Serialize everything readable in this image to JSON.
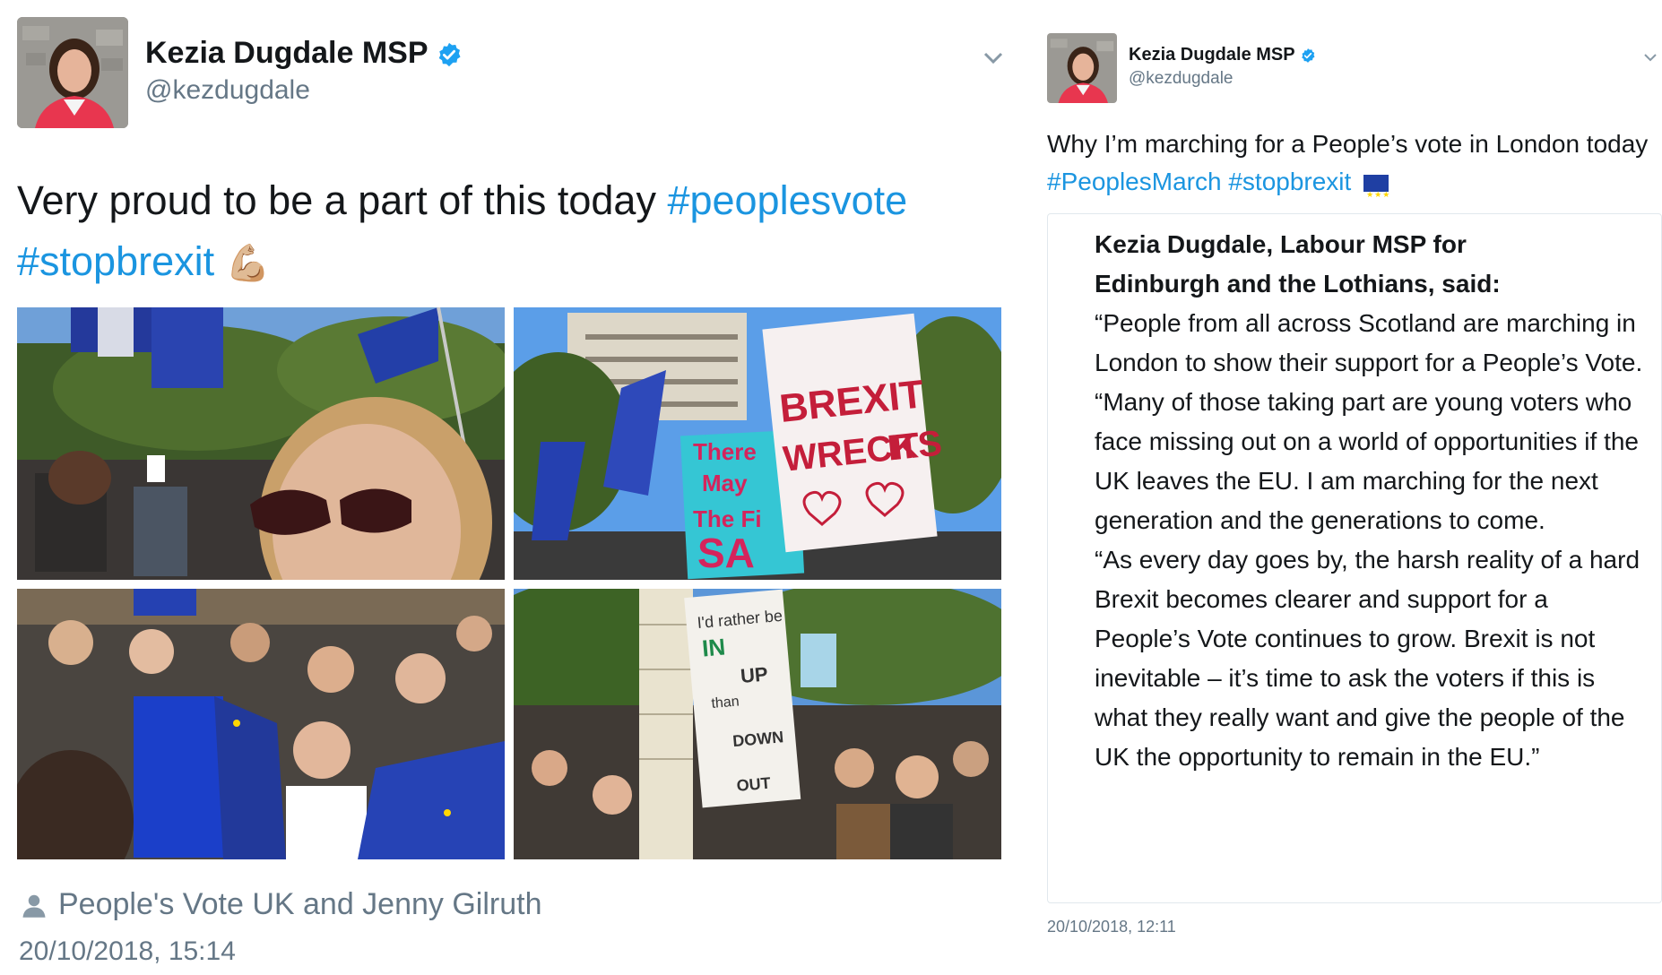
{
  "left_tweet": {
    "name": "Kezia Dugdale MSP",
    "handle": "@kezdugdale",
    "text_plain": "Very proud to be a part of this today ",
    "hashtag1": "#peoplesvote",
    "hashtag2": "#stopbrexit",
    "emoji": "💪🏼",
    "tagged": "People's Vote UK and Jenny Gilruth",
    "timestamp": "20/10/2018, 15:14",
    "sign_brexit_line1": "BREXIT",
    "sign_brexit_line2": "WRECKS IT",
    "sign_say": "There May We Have The Final SAY",
    "sign_rather": "I'd rather be IN and UP than DOWN and OUT"
  },
  "right_tweet": {
    "name": "Kezia Dugdale MSP",
    "handle": "@kezdugdale",
    "text_plain": "Why I’m marching for a People’s vote in London today",
    "hashtag1": "#PeoplesMarch",
    "hashtag2": "#stopbrexit",
    "card_heading_line1": "Kezia Dugdale, Labour MSP for",
    "card_heading_line2": "Edinburgh and the Lothians, said:",
    "card_para1": "“People from all across Scotland are marching in London to show their support for a People’s Vote.",
    "card_para2": "“Many of those taking part are young voters who face missing out on a world of opportunities if the UK leaves the EU. I am marching for the next generation and the generations to come.",
    "card_para3": "“As every day goes by, the harsh reality of a hard Brexit becomes clearer and support for a People’s Vote continues to grow. Brexit is not inevitable – it’s time to ask the voters if this is what they really want and give the people of the UK the opportunity to remain in the EU.”",
    "timestamp": "20/10/2018, 12:11"
  },
  "colors": {
    "link": "#1b95e0",
    "verified": "#1da1f2",
    "secondary_text": "#657786",
    "eu_blue": "#1f3fa3"
  },
  "icons": [
    "verified-badge-icon",
    "chevron-down-icon",
    "person-icon",
    "eu-flag-icon"
  ]
}
